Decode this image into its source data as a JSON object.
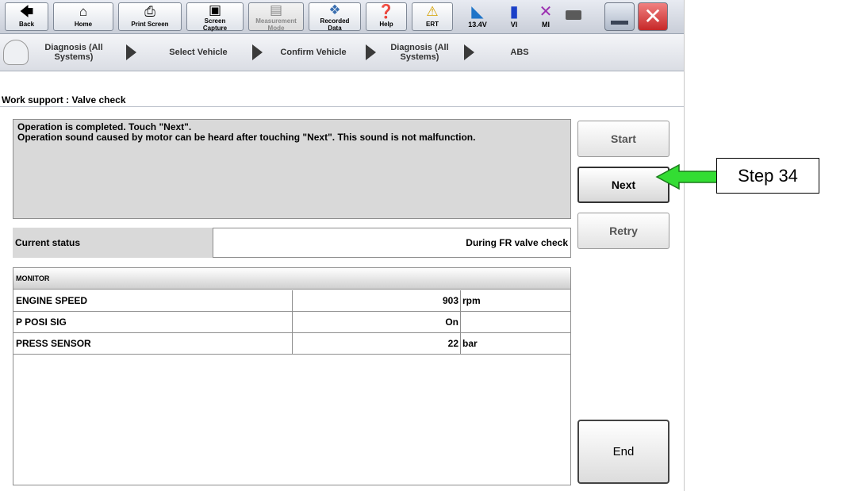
{
  "toolbar": {
    "buttons": [
      {
        "label": "Back",
        "icon": "arrow-up-icon"
      },
      {
        "label": "Home",
        "icon": "home-icon"
      },
      {
        "label": "Print Screen",
        "icon": "printer-icon"
      },
      {
        "label": "Screen\nCapture",
        "icon": "camera-icon"
      },
      {
        "label": "Measurement\nMode",
        "icon": "meter-icon"
      },
      {
        "label": "Recorded\nData",
        "icon": "recorded-data-icon"
      },
      {
        "label": "Help",
        "icon": "help-icon"
      },
      {
        "label": "ERT",
        "icon": "warning-icon"
      }
    ],
    "battery_voltage": "13.4V",
    "vi_label": "VI",
    "mi_label": "MI"
  },
  "breadcrumb": {
    "items": [
      "Diagnosis (All\nSystems)",
      "Select Vehicle",
      "Confirm Vehicle",
      "Diagnosis (All\nSystems)",
      "ABS"
    ]
  },
  "page_title": "Work support : Valve check",
  "message": "Operation is completed. Touch \"Next\".\nOperation sound caused by motor can be heard after touching \"Next\". This sound is not malfunction.",
  "side_buttons": {
    "start": "Start",
    "next": "Next",
    "retry": "Retry",
    "end": "End"
  },
  "current_status": {
    "label": "Current status",
    "value": "During FR valve check"
  },
  "monitor": {
    "header": "MONITOR",
    "rows": [
      {
        "name": "ENGINE SPEED",
        "value": "903",
        "unit": "rpm"
      },
      {
        "name": "P POSI SIG",
        "value": "On",
        "unit": ""
      },
      {
        "name": "PRESS SENSOR",
        "value": "22",
        "unit": "bar"
      }
    ]
  },
  "callout": {
    "label": "Step 34"
  },
  "colors": {
    "callout_arrow": "#33dd33",
    "close_button": "#e04040"
  }
}
